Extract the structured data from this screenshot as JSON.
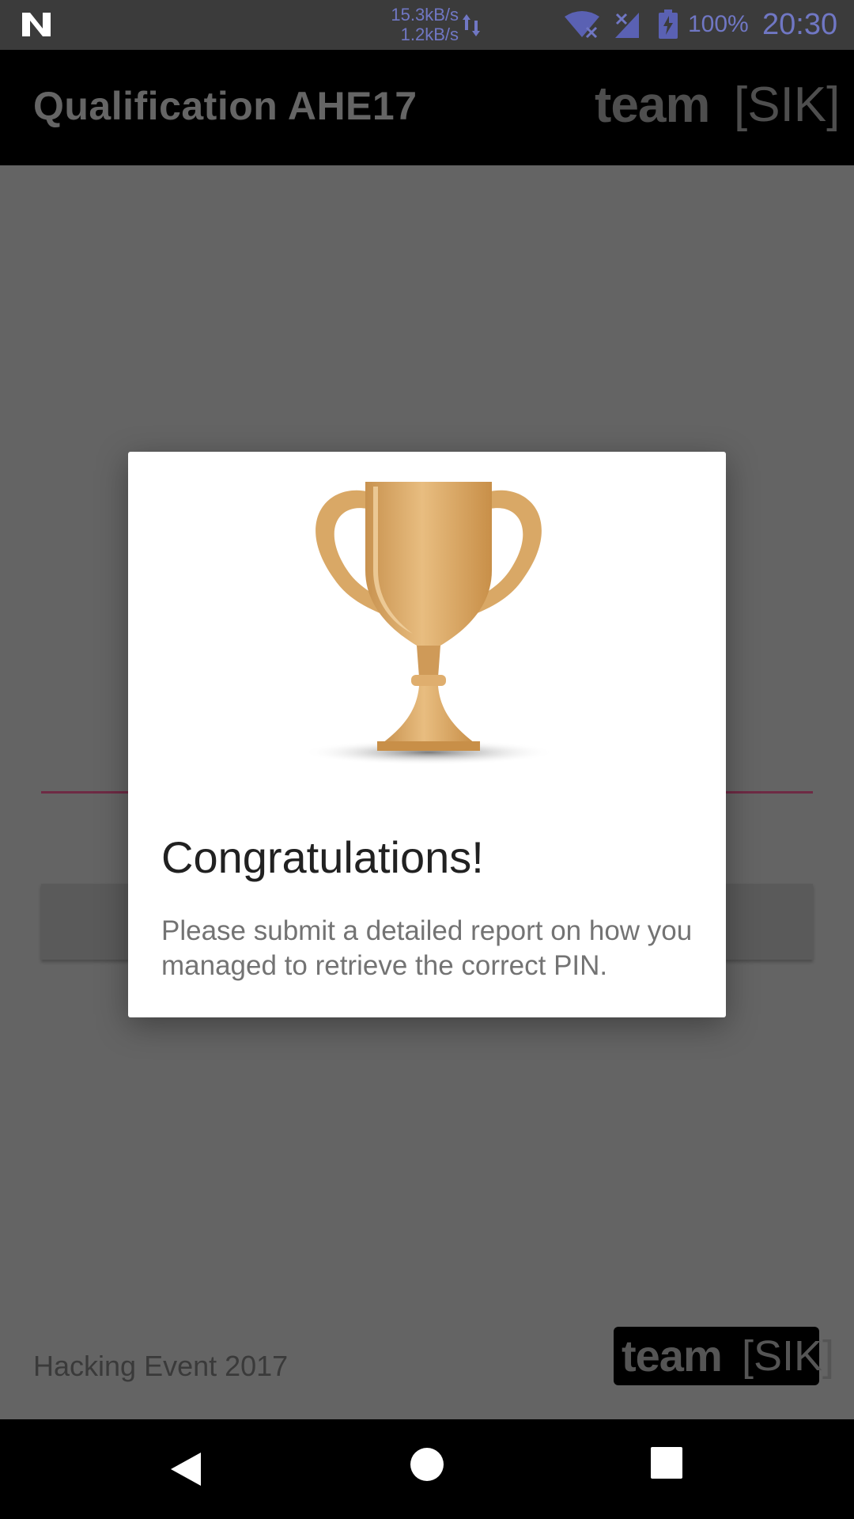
{
  "status_bar": {
    "net_down": "15.3kB/s",
    "net_up": "1.2kB/s",
    "battery_percent": "100%",
    "time": "20:30",
    "icons": [
      "n-notification-icon",
      "data-transfer-icon",
      "wifi-icon",
      "signal-icon",
      "battery-charging-icon"
    ]
  },
  "app_bar": {
    "title": "Qualification AHE17",
    "logo_team": "team",
    "logo_sik": "[SIK]"
  },
  "dialog": {
    "title": "Congratulations!",
    "message": "Please submit a detailed report on how you managed to retrieve the correct PIN.",
    "icon": "trophy-icon"
  },
  "footer": {
    "text": "Hacking Event 2017",
    "logo_team": "team",
    "logo_sik": "[SIK]"
  },
  "nav_bar": {
    "icons": [
      "back-icon",
      "home-icon",
      "recents-icon"
    ]
  },
  "colors": {
    "status_text": "#7077c4",
    "accent_underline": "#6e2a44",
    "trophy_gold": "#d9a866"
  }
}
